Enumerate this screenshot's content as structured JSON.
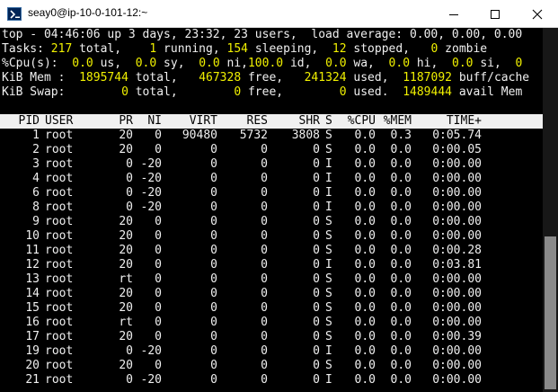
{
  "window": {
    "title": "seay0@ip-10-0-101-12:~"
  },
  "summary": {
    "line1": "top - 04:46:06 up 3 days, 23:32, 23 users,  load average: 0.00, 0.00, 0.00",
    "tasks": {
      "label": "Tasks:",
      "total": "217",
      "total_l": "total,",
      "running": "1",
      "running_l": "running,",
      "sleeping": "154",
      "sleeping_l": "sleeping,",
      "stopped": "12",
      "stopped_l": "stopped,",
      "zombie": "0",
      "zombie_l": "zombie"
    },
    "cpu": {
      "label": "%Cpu(s):",
      "us": "0.0",
      "us_l": "us,",
      "sy": "0.0",
      "sy_l": "sy,",
      "ni": "0.0",
      "ni_l": "ni,",
      "id": "100.0",
      "id_l": "id,",
      "wa": "0.0",
      "wa_l": "wa,",
      "hi": "0.0",
      "hi_l": "hi,",
      "si": "0.0",
      "si_l": "si,",
      "st": "0"
    },
    "mem": {
      "label": "KiB Mem :",
      "total": "1895744",
      "total_l": "total,",
      "free": "467328",
      "free_l": "free,",
      "used": "241324",
      "used_l": "used,",
      "cache": "1187092",
      "cache_l": "buff/cache"
    },
    "swap": {
      "label": "KiB Swap:",
      "total": "0",
      "total_l": "total,",
      "free": "0",
      "free_l": "free,",
      "used": "0",
      "used_l": "used.",
      "avail": "1489444",
      "avail_l": "avail Mem"
    }
  },
  "columns": {
    "pid": "PID",
    "user": "USER",
    "pr": "PR",
    "ni": "NI",
    "virt": "VIRT",
    "res": "RES",
    "shr": "SHR",
    "s": "S",
    "cpu": "%CPU",
    "mem": "%MEM",
    "time": "TIME+"
  },
  "processes": [
    {
      "pid": "1",
      "user": "root",
      "pr": "20",
      "ni": "0",
      "virt": "90480",
      "res": "5732",
      "shr": "3808",
      "s": "S",
      "cpu": "0.0",
      "mem": "0.3",
      "time": "0:05.74"
    },
    {
      "pid": "2",
      "user": "root",
      "pr": "20",
      "ni": "0",
      "virt": "0",
      "res": "0",
      "shr": "0",
      "s": "S",
      "cpu": "0.0",
      "mem": "0.0",
      "time": "0:00.05"
    },
    {
      "pid": "3",
      "user": "root",
      "pr": "0",
      "ni": "-20",
      "virt": "0",
      "res": "0",
      "shr": "0",
      "s": "I",
      "cpu": "0.0",
      "mem": "0.0",
      "time": "0:00.00"
    },
    {
      "pid": "4",
      "user": "root",
      "pr": "0",
      "ni": "-20",
      "virt": "0",
      "res": "0",
      "shr": "0",
      "s": "I",
      "cpu": "0.0",
      "mem": "0.0",
      "time": "0:00.00"
    },
    {
      "pid": "6",
      "user": "root",
      "pr": "0",
      "ni": "-20",
      "virt": "0",
      "res": "0",
      "shr": "0",
      "s": "I",
      "cpu": "0.0",
      "mem": "0.0",
      "time": "0:00.00"
    },
    {
      "pid": "8",
      "user": "root",
      "pr": "0",
      "ni": "-20",
      "virt": "0",
      "res": "0",
      "shr": "0",
      "s": "I",
      "cpu": "0.0",
      "mem": "0.0",
      "time": "0:00.00"
    },
    {
      "pid": "9",
      "user": "root",
      "pr": "20",
      "ni": "0",
      "virt": "0",
      "res": "0",
      "shr": "0",
      "s": "S",
      "cpu": "0.0",
      "mem": "0.0",
      "time": "0:00.00"
    },
    {
      "pid": "10",
      "user": "root",
      "pr": "20",
      "ni": "0",
      "virt": "0",
      "res": "0",
      "shr": "0",
      "s": "S",
      "cpu": "0.0",
      "mem": "0.0",
      "time": "0:00.00"
    },
    {
      "pid": "11",
      "user": "root",
      "pr": "20",
      "ni": "0",
      "virt": "0",
      "res": "0",
      "shr": "0",
      "s": "S",
      "cpu": "0.0",
      "mem": "0.0",
      "time": "0:00.28"
    },
    {
      "pid": "12",
      "user": "root",
      "pr": "20",
      "ni": "0",
      "virt": "0",
      "res": "0",
      "shr": "0",
      "s": "I",
      "cpu": "0.0",
      "mem": "0.0",
      "time": "0:03.81"
    },
    {
      "pid": "13",
      "user": "root",
      "pr": "rt",
      "ni": "0",
      "virt": "0",
      "res": "0",
      "shr": "0",
      "s": "S",
      "cpu": "0.0",
      "mem": "0.0",
      "time": "0:00.00"
    },
    {
      "pid": "14",
      "user": "root",
      "pr": "20",
      "ni": "0",
      "virt": "0",
      "res": "0",
      "shr": "0",
      "s": "S",
      "cpu": "0.0",
      "mem": "0.0",
      "time": "0:00.00"
    },
    {
      "pid": "15",
      "user": "root",
      "pr": "20",
      "ni": "0",
      "virt": "0",
      "res": "0",
      "shr": "0",
      "s": "S",
      "cpu": "0.0",
      "mem": "0.0",
      "time": "0:00.00"
    },
    {
      "pid": "16",
      "user": "root",
      "pr": "rt",
      "ni": "0",
      "virt": "0",
      "res": "0",
      "shr": "0",
      "s": "S",
      "cpu": "0.0",
      "mem": "0.0",
      "time": "0:00.00"
    },
    {
      "pid": "17",
      "user": "root",
      "pr": "20",
      "ni": "0",
      "virt": "0",
      "res": "0",
      "shr": "0",
      "s": "S",
      "cpu": "0.0",
      "mem": "0.0",
      "time": "0:00.39"
    },
    {
      "pid": "19",
      "user": "root",
      "pr": "0",
      "ni": "-20",
      "virt": "0",
      "res": "0",
      "shr": "0",
      "s": "I",
      "cpu": "0.0",
      "mem": "0.0",
      "time": "0:00.00"
    },
    {
      "pid": "20",
      "user": "root",
      "pr": "20",
      "ni": "0",
      "virt": "0",
      "res": "0",
      "shr": "0",
      "s": "S",
      "cpu": "0.0",
      "mem": "0.0",
      "time": "0:00.00"
    },
    {
      "pid": "21",
      "user": "root",
      "pr": "0",
      "ni": "-20",
      "virt": "0",
      "res": "0",
      "shr": "0",
      "s": "I",
      "cpu": "0.0",
      "mem": "0.0",
      "time": "0:00.00"
    }
  ],
  "icons": {
    "app": "powershell-icon",
    "minimize": "minimize-icon",
    "maximize": "maximize-icon",
    "close": "close-icon"
  },
  "colors": {
    "background": "#000000",
    "text": "#f0f0f0",
    "value_highlight": "#f0f000",
    "header_bg": "#f0f0f0"
  }
}
